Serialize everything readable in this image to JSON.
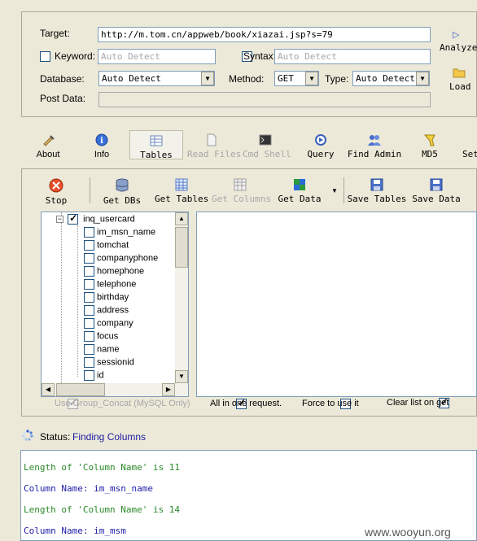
{
  "form": {
    "target_label": "Target:",
    "target_value": "http://m.tom.cn/appweb/book/xiazai.jsp?s=79",
    "keyword_label": "Keyword:",
    "keyword_placeholder": "Auto Detect",
    "syntax_label": "Syntax:",
    "syntax_placeholder": "Auto Detect",
    "database_label": "Database:",
    "database_value": "Auto Detect",
    "method_label": "Method:",
    "method_value": "GET",
    "type_label": "Type:",
    "type_value": "Auto Detect",
    "postdata_label": "Post Data:"
  },
  "side_buttons": {
    "analyze": "Analyze",
    "load": "Load S"
  },
  "main_toolbar": [
    {
      "label": "About",
      "icon": "syringe-icon",
      "enabled": true
    },
    {
      "label": "Info",
      "icon": "info-icon",
      "enabled": true
    },
    {
      "label": "Tables",
      "icon": "table-icon",
      "enabled": true,
      "selected": true
    },
    {
      "label": "Read Files",
      "icon": "file-icon",
      "enabled": false
    },
    {
      "label": "Cmd Shell",
      "icon": "terminal-icon",
      "enabled": false
    },
    {
      "label": "Query",
      "icon": "query-icon",
      "enabled": true
    },
    {
      "label": "Find Admin",
      "icon": "users-icon",
      "enabled": true
    },
    {
      "label": "MD5",
      "icon": "key-icon",
      "enabled": true
    },
    {
      "label": "Set",
      "icon": "settings-icon",
      "enabled": true
    }
  ],
  "sub_toolbar": [
    {
      "label": "Stop",
      "icon": "stop-icon",
      "enabled": true
    },
    {
      "label": "Get DBs",
      "icon": "database-icon",
      "enabled": true
    },
    {
      "label": "Get Tables",
      "icon": "grid-icon",
      "enabled": true
    },
    {
      "label": "Get Columns",
      "icon": "columns-icon",
      "enabled": false
    },
    {
      "label": "Get Data",
      "icon": "data-icon",
      "enabled": true
    },
    {
      "label": "Save Tables",
      "icon": "save-icon",
      "enabled": true
    },
    {
      "label": "Save Data",
      "icon": "save-icon",
      "enabled": true
    }
  ],
  "tree": {
    "table": {
      "label": "inq_usercard",
      "checked": true
    },
    "columns": [
      "im_msn_name",
      "tomchat",
      "companyphone",
      "homephone",
      "telephone",
      "birthday",
      "address",
      "company",
      "focus",
      "name",
      "sessionid",
      "id"
    ]
  },
  "options": {
    "group_concat": "Use Group_Concat (MySQL Only)",
    "all_in_one": "All in one request.",
    "force": "Force to use it",
    "clear_list": "Clear list on get"
  },
  "status": {
    "label": "Status:",
    "value": "Finding Columns"
  },
  "log": [
    {
      "text": "Length of 'Column Name' is 11",
      "color": "#2a8a2a"
    },
    {
      "text": "Column Name: im_msn_name",
      "color": "#1c1ca8"
    },
    {
      "text": "Length of 'Column Name' is 14",
      "color": "#2a8a2a"
    },
    {
      "text": "Column Name: im_msm",
      "color": "#1c1ca8"
    }
  ],
  "watermark": "www.wooyun.org"
}
